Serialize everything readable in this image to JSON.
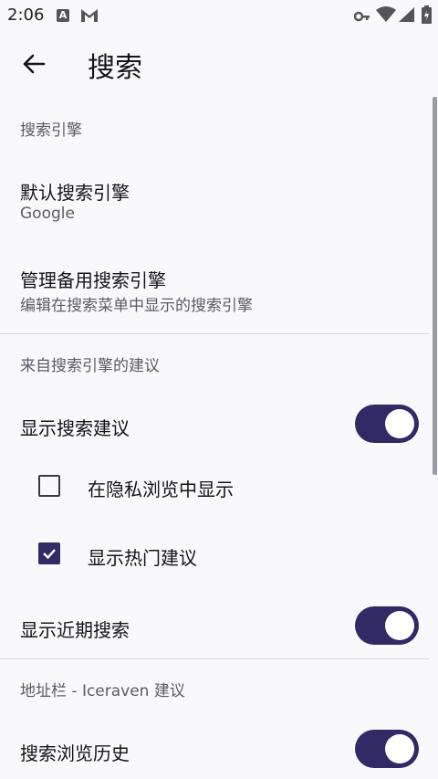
{
  "status_bar": {
    "time": "2:06",
    "notification_a": "A"
  },
  "app_bar": {
    "title": "搜索"
  },
  "sections": {
    "search_engine": "搜索引擎",
    "suggestions": "来自搜索引擎的建议",
    "address_bar": "地址栏 - Iceraven 建议"
  },
  "default_engine": {
    "title": "默认搜索引擎",
    "value": "Google"
  },
  "manage_engines": {
    "title": "管理备用搜索引擎",
    "subtitle": "编辑在搜索菜单中显示的搜索引擎"
  },
  "show_suggestions": {
    "label": "显示搜索建议",
    "on": true
  },
  "private_browsing": {
    "label": "在隐私浏览中显示",
    "checked": false
  },
  "trending": {
    "label": "显示热门建议",
    "checked": true
  },
  "recent_searches": {
    "label": "显示近期搜索",
    "on": true
  },
  "browsing_history": {
    "label": "搜索浏览历史",
    "on": true
  },
  "colors": {
    "accent": "#312a64",
    "background": "#f9f9fb",
    "text_primary": "#15141a",
    "text_secondary": "#5b5b66"
  }
}
